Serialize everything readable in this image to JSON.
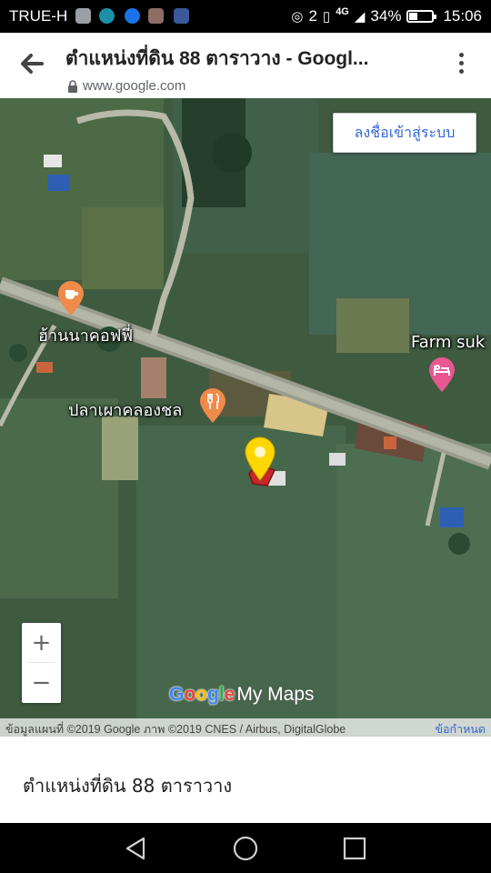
{
  "status_bar": {
    "carrier": "TRUE-H",
    "sim_count": "2",
    "network": "4G",
    "battery_percent": "34%",
    "battery_level": 0.34,
    "time": "15:06",
    "notification_icons": [
      "gallery-icon",
      "download-icon",
      "messenger-icon",
      "avatar-icon",
      "facebook-icon"
    ]
  },
  "browser": {
    "title": "ตำแหน่งที่ดิน 88 ตาราวาง - Googl...",
    "url": "www.google.com"
  },
  "map": {
    "signin_label": "ลงชื่อเข้าสู่ระบบ",
    "pois": [
      {
        "name": "ฮ้านนาคอฟฟี่",
        "type": "cafe",
        "color": "#f08a4b"
      },
      {
        "name": "ปลาเผาคลองชล",
        "type": "restaurant",
        "color": "#f08a4b"
      },
      {
        "name": "Farm suk",
        "type": "hotel",
        "color": "#e8578f"
      }
    ],
    "marker_color": "#ffd600",
    "zoom_in": "+",
    "zoom_out": "−",
    "logo_google": "Google",
    "logo_mymaps": "My Maps",
    "attribution": "ข้อมูลแผนที่ ©2019 Google ภาพ ©2019 CNES / Airbus, DigitalGlobe",
    "terms": "ข้อกำหนด"
  },
  "info_panel": {
    "title": "ตำแหน่งที่ดิน 88 ตาราวาง"
  },
  "nav": {
    "buttons": [
      "back-nav-icon",
      "home-nav-icon",
      "recents-nav-icon"
    ]
  }
}
